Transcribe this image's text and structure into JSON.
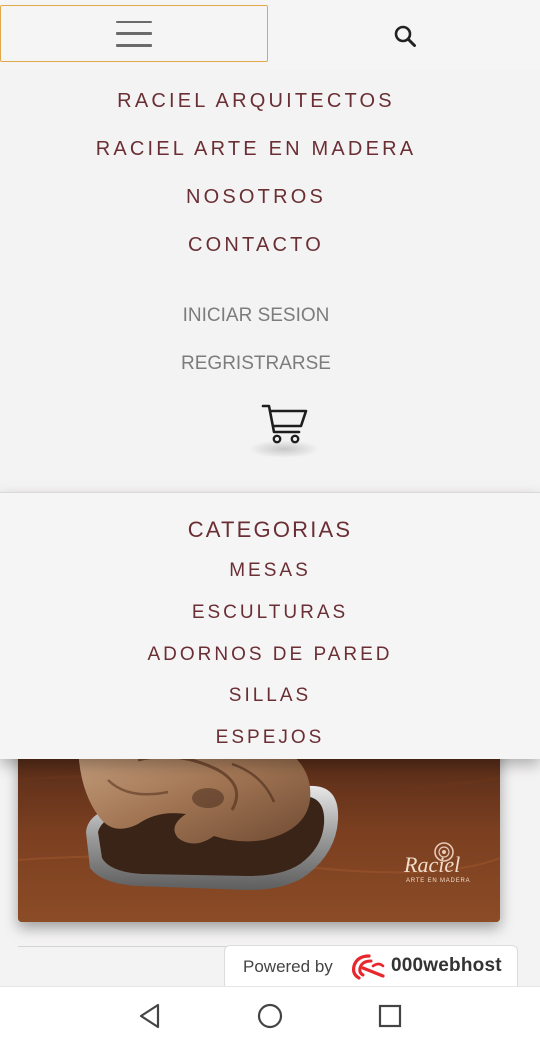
{
  "menu": {
    "items": [
      {
        "label": "RACIEL ARQUITECTOS"
      },
      {
        "label": "RACIEL ARTE EN MADERA"
      },
      {
        "label": "NOSOTROS"
      },
      {
        "label": "CONTACTO"
      }
    ],
    "account": {
      "login_label": "INICIAR SESION",
      "register_label": "REGRISTRARSE"
    }
  },
  "categories": {
    "title": "CATEGORIAS",
    "items": [
      {
        "label": "MESAS"
      },
      {
        "label": "ESCULTURAS"
      },
      {
        "label": "ADORNOS DE PARED"
      },
      {
        "label": "SILLAS"
      },
      {
        "label": "ESPEJOS"
      }
    ]
  },
  "product": {
    "logo_text": "Raciel",
    "logo_subtitle": "ARTE EN MADERA"
  },
  "footer_badge": {
    "powered_label": "Powered by",
    "brand": "000webhost"
  },
  "icons": {
    "menu": "hamburger-icon",
    "search": "search-icon",
    "cart": "cart-icon",
    "back": "back-icon",
    "home": "home-icon",
    "recents": "recents-icon"
  },
  "colors": {
    "accent_text": "#6a2f34",
    "muted_text": "#7c7c7c",
    "focus_border": "#e2a94a",
    "webhost_red": "#e8262d"
  }
}
